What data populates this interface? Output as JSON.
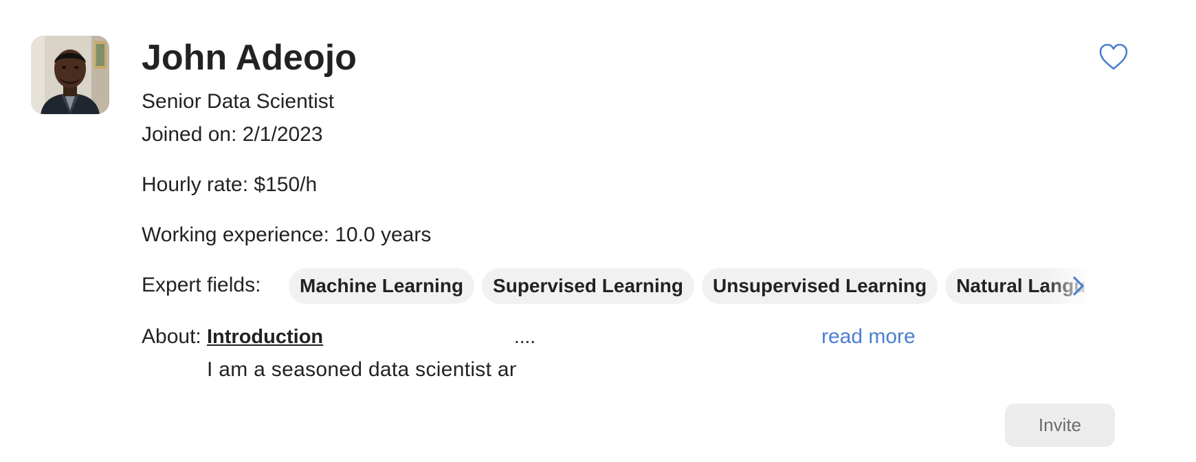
{
  "profile": {
    "name": "John Adeojo",
    "title": "Senior Data Scientist",
    "joined": "Joined on: 2/1/2023",
    "hourly_rate": "Hourly rate: $150/h",
    "experience": "Working experience: 10.0 years",
    "avatar_icon": "person-photo",
    "favorite_icon": "heart-outline-icon"
  },
  "expert_fields": {
    "label": "Expert fields:",
    "chips": [
      "Machine Learning",
      "Supervised Learning",
      "Unsupervised Learning",
      "Natural Language"
    ],
    "scroll_icon": "chevron-right-icon"
  },
  "about": {
    "label": "About:",
    "heading": "Introduction",
    "text": "I am a seasoned data scientist and",
    "ellipsis": "....",
    "read_more": "read more"
  },
  "actions": {
    "invite_label": "Invite"
  },
  "colors": {
    "accent": "#4a7fd0",
    "chip_bg": "#f1f1f1",
    "button_bg": "#ececec",
    "text": "#222222"
  }
}
